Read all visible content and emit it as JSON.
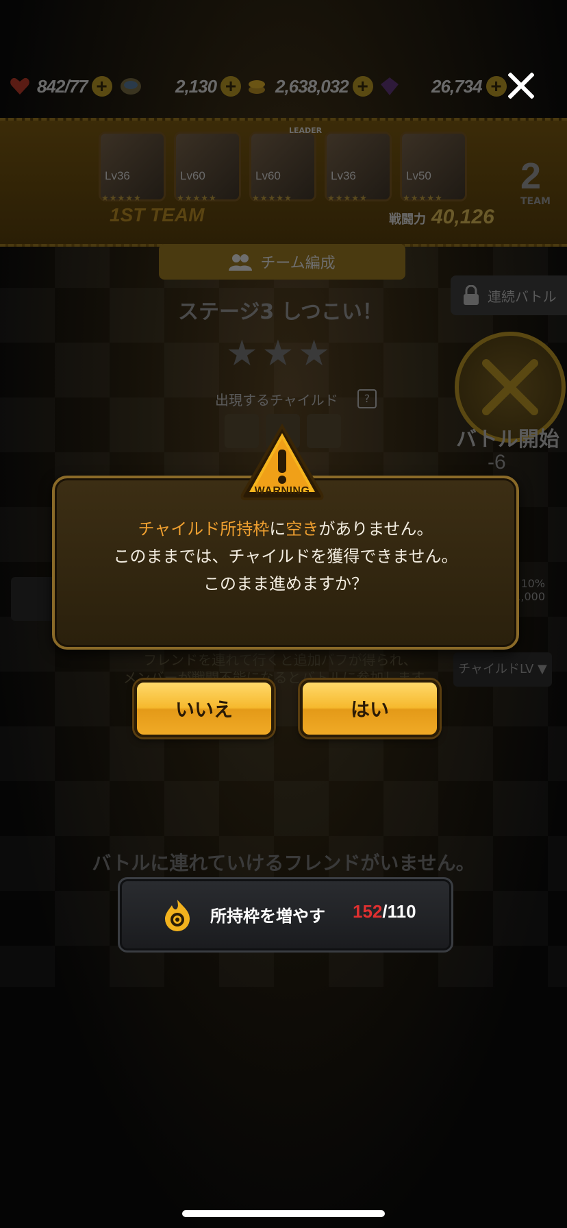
{
  "resources": {
    "stamina": "842/77",
    "item": "2,130",
    "coins": "2,638,032",
    "gems": "26,734"
  },
  "team": {
    "members": [
      {
        "lv": "Lv36"
      },
      {
        "lv": "Lv60"
      },
      {
        "lv": "Lv60"
      },
      {
        "lv": "Lv36"
      },
      {
        "lv": "Lv50"
      }
    ],
    "leader_tag": "LEADER",
    "label": "1ST TEAM",
    "power_label": "戦闘力",
    "power_value": "40,126",
    "next_team_num": "2",
    "next_team_label": "TEAM"
  },
  "team_edit_label": "チーム編成",
  "continuous_battle_label": "連続バトル",
  "stage_title": "ステージ3 しつこい！",
  "appear_label": "出現するチャイルド",
  "appear_help": "?",
  "battle_start_label": "バトル開始",
  "battle_cost": "-6",
  "side_pct": "10%",
  "side_num": "1,000",
  "friend_note": {
    "line1": "フレンドを連れて行くと追加バフが得られ、",
    "line2": "メンバーが戦闘不能になるとバトルに参加します。"
  },
  "child_lv_filter": "チャイルドLV ▼",
  "no_friends": "バトルに連れていけるフレンドがいません。",
  "slot_bar": {
    "label": "所持枠を増やす",
    "current": "152",
    "separator": "/",
    "max": "110"
  },
  "dialog": {
    "badge": "WARNING",
    "line1_hl1": "チャイルド所持枠",
    "line1_mid": "に",
    "line1_hl2": "空き",
    "line1_end": "がありません。",
    "line2": "このままでは、チャイルドを獲得できません。",
    "line3": "このまま進めますか？"
  },
  "buttons": {
    "no": "いいえ",
    "yes": "はい"
  },
  "colors": {
    "accent": "#f0a030",
    "button": "#f6b92e",
    "count_red": "#e03030"
  }
}
